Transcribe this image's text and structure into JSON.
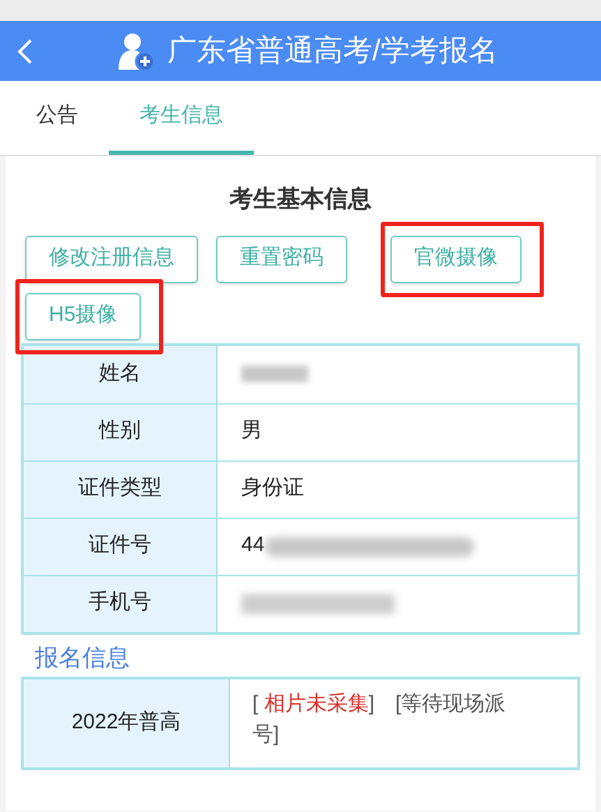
{
  "header": {
    "title": "广东省普通高考/学考报名"
  },
  "tabs": [
    {
      "label": "公告",
      "selected": false
    },
    {
      "label": "考生信息",
      "selected": true
    }
  ],
  "section_title": "考生基本信息",
  "buttons": [
    {
      "label": "修改注册信息",
      "highlighted": false
    },
    {
      "label": "重置密码",
      "highlighted": false
    },
    {
      "label": "官微摄像",
      "highlighted": true
    },
    {
      "label": "H5摄像",
      "highlighted": true
    }
  ],
  "info_rows": [
    {
      "label": "姓名",
      "value": "",
      "redacted": true
    },
    {
      "label": "性别",
      "value": "男",
      "redacted": false
    },
    {
      "label": "证件类型",
      "value": "身份证",
      "redacted": false
    },
    {
      "label": "证件号",
      "value": "44",
      "redacted": true
    },
    {
      "label": "手机号",
      "value": "",
      "redacted": true
    }
  ],
  "registration_title": "报名信息",
  "registrations": [
    {
      "exam": "2022年普高",
      "status": [
        {
          "text": "[ ",
          "alert": false
        },
        {
          "text": "相片未采集",
          "alert": true
        },
        {
          "text": "]　[等待现场派号]",
          "alert": false
        }
      ]
    }
  ]
}
